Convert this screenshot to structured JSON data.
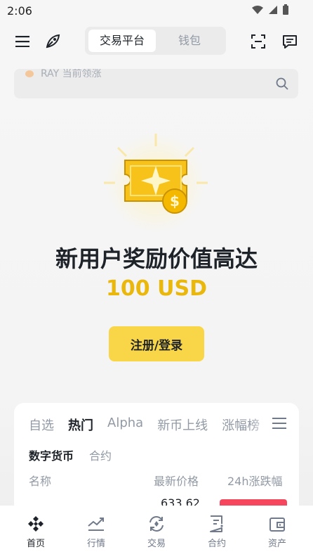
{
  "status": {
    "time": "2:06"
  },
  "header": {
    "tabs": [
      {
        "label": "交易平台",
        "active": true
      },
      {
        "label": "钱包",
        "active": false
      }
    ]
  },
  "search": {
    "placeholder_text": "RAY 当前领涨"
  },
  "hero": {
    "title": "新用户奖励价值高达",
    "amount": "100 USD",
    "cta_label": "注册/登录"
  },
  "market": {
    "tabs": [
      "自选",
      "热门",
      "Alpha",
      "新币上线",
      "涨幅榜"
    ],
    "active_tab": "热门",
    "subtabs": [
      "数字货币",
      "合约"
    ],
    "active_subtab": "数字货币",
    "columns": {
      "name": "名称",
      "price": "最新价格",
      "change": "24h涨跌幅"
    },
    "first_row_price": "633.62"
  },
  "nav": {
    "items": [
      {
        "label": "首页",
        "icon": "binance-logo-icon",
        "active": true
      },
      {
        "label": "行情",
        "icon": "chart-line-icon",
        "active": false
      },
      {
        "label": "交易",
        "icon": "trade-swap-icon",
        "active": false
      },
      {
        "label": "合约",
        "icon": "futures-doc-icon",
        "active": false
      },
      {
        "label": "资产",
        "icon": "wallet-icon",
        "active": false
      }
    ]
  },
  "colors": {
    "accent_yellow": "#f9d648",
    "amount_gold": "#eab80d",
    "down_red": "#f6465d"
  }
}
